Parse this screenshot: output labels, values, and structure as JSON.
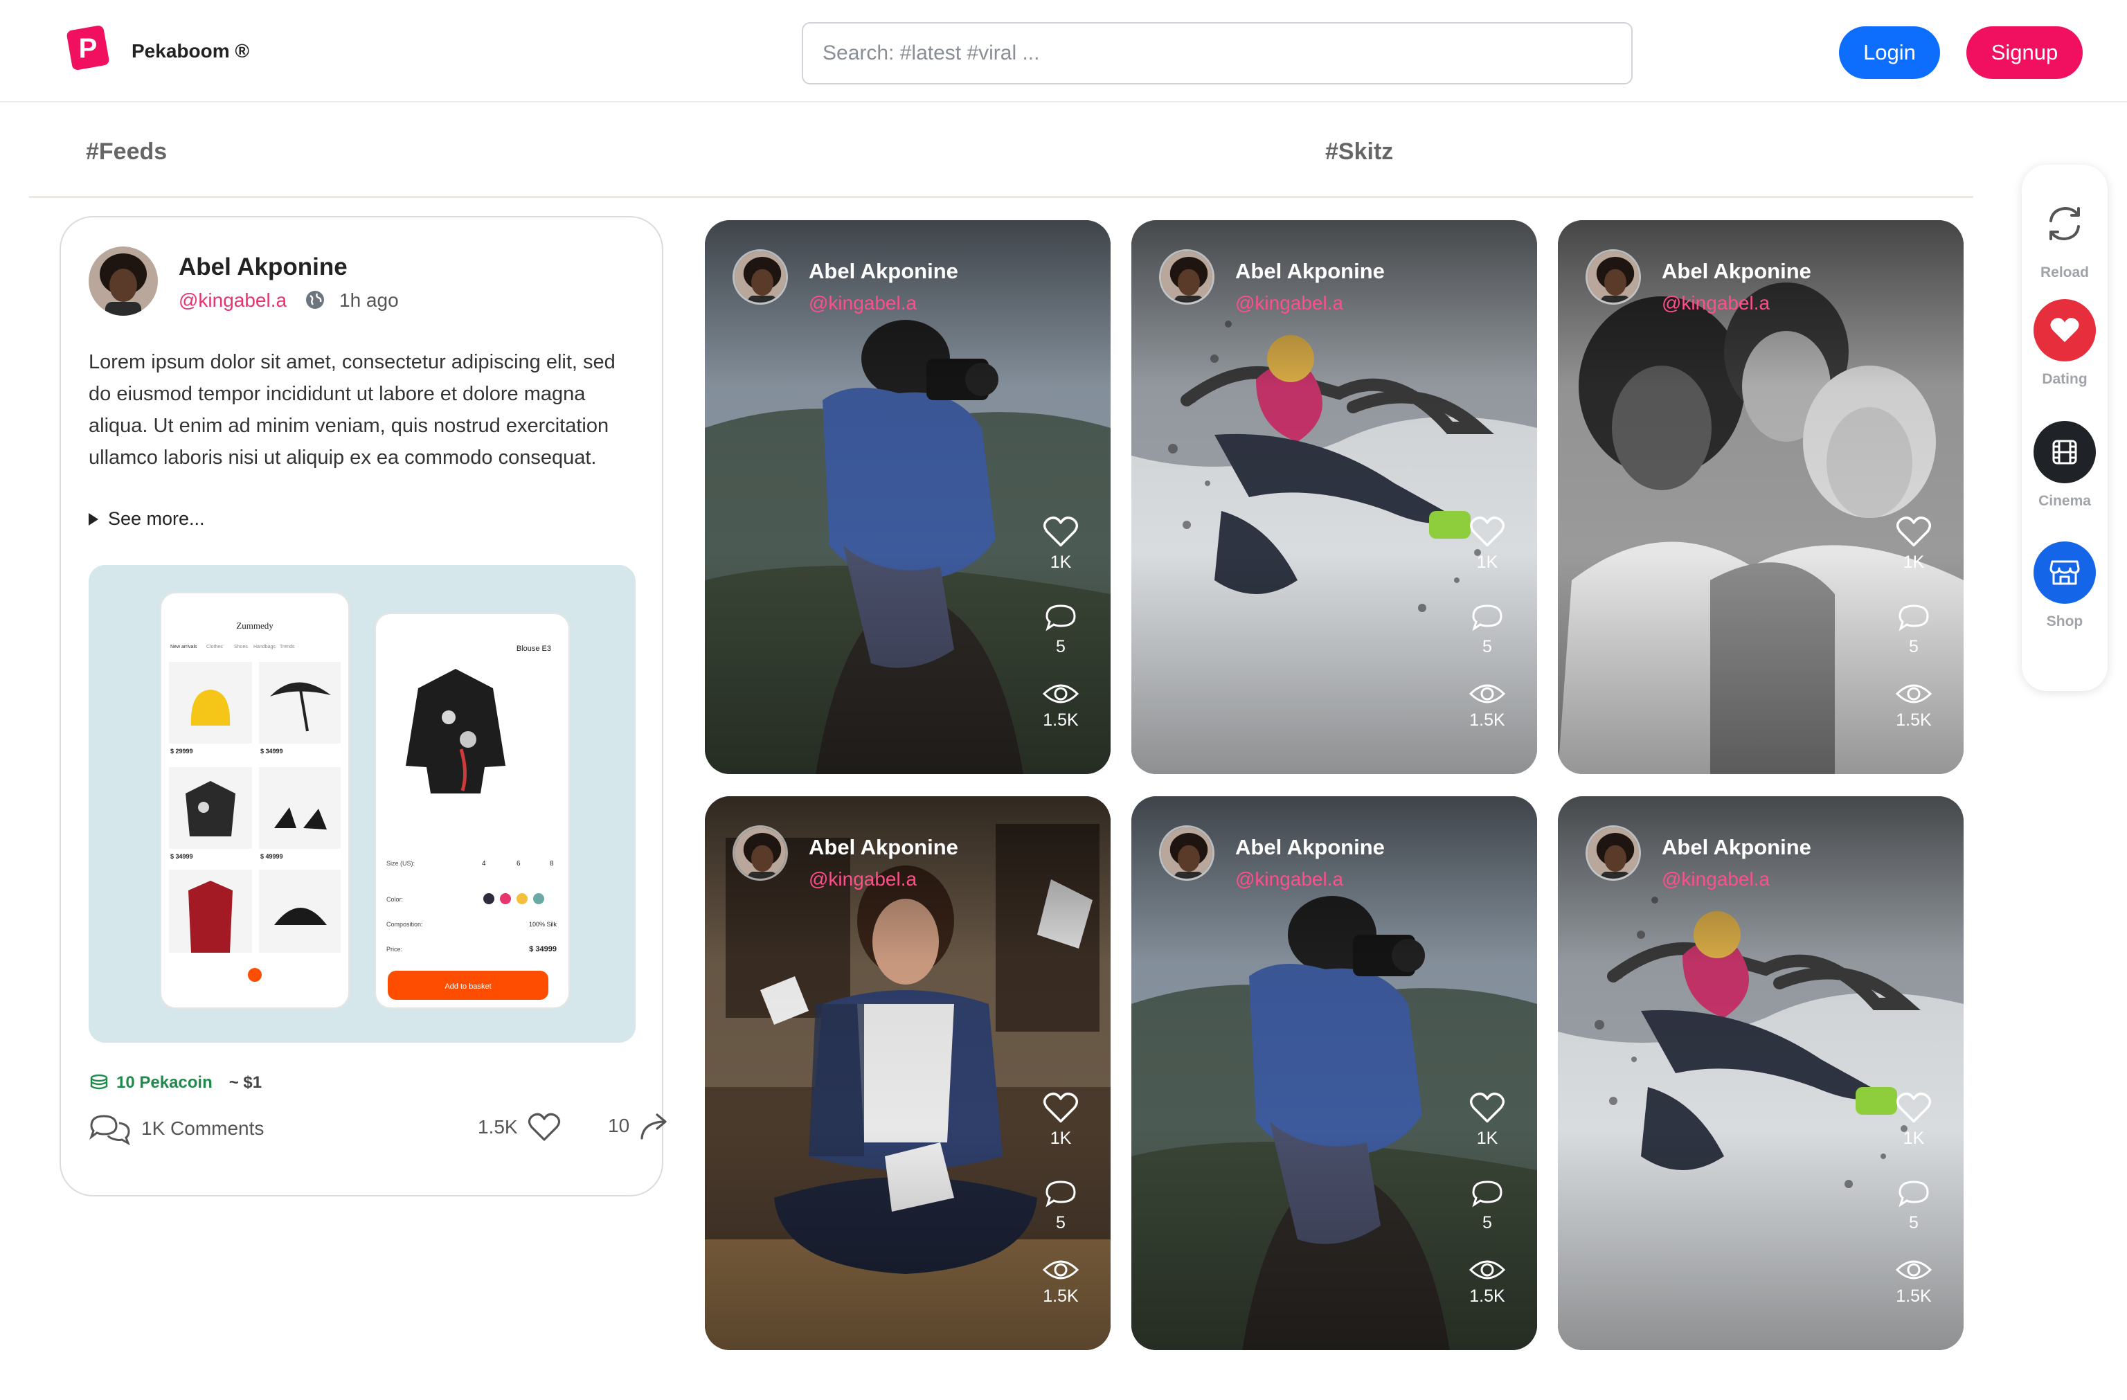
{
  "header": {
    "logo_letter": "P",
    "brand": "Pekaboom ®",
    "search_placeholder": "Search: #latest #viral ...",
    "login_label": "Login",
    "signup_label": "Signup"
  },
  "tabs": {
    "feeds": "#Feeds",
    "skitz": "#Skitz"
  },
  "post": {
    "author": "Abel Akponine",
    "handle": "@kingabel.a",
    "time": "1h ago",
    "text": "Lorem ipsum dolor sit amet, consectetur adipiscing elit, sed do eiusmod tempor incididunt ut labore et dolore magna aliqua. Ut enim ad minim veniam, quis nostrud exercitation ullamco laboris nisi ut aliquip ex ea commodo consequat.",
    "see_more": "See more...",
    "coin_amount": "10 Pekacoin",
    "coin_value": "~ $1",
    "comments": "1K Comments",
    "likes": "1.5K",
    "shares": "10",
    "media": {
      "phone1_title": "Zummedy",
      "phone1_tabs": [
        "New arrivals",
        "Clothes",
        "Shoes",
        "Handbags",
        "Trends"
      ],
      "phone1_price1": "$ 29999",
      "phone1_price2": "$ 34999",
      "phone1_price3": "$ 34999",
      "phone1_price4": "$ 49999",
      "phone2_title": "Blouse E3",
      "size_label": "Size (US):",
      "sizes": [
        "4",
        "6",
        "8"
      ],
      "color_label": "Color:",
      "composition_label": "Composition:",
      "composition_value": "100% Silk",
      "price_label": "Price:",
      "price_value": "$ 34999",
      "basket_label": "Add to basket"
    }
  },
  "skitz": [
    {
      "name": "Abel Akponine",
      "handle": "@kingabel.a",
      "likes": "1K",
      "comments": "5",
      "views": "1.5K",
      "scene": "photographer"
    },
    {
      "name": "Abel Akponine",
      "handle": "@kingabel.a",
      "likes": "1K",
      "comments": "5",
      "views": "1.5K",
      "scene": "dancer"
    },
    {
      "name": "Abel Akponine",
      "handle": "@kingabel.a",
      "likes": "1K",
      "comments": "5",
      "views": "1.5K",
      "scene": "friends"
    },
    {
      "name": "Abel Akponine",
      "handle": "@kingabel.a",
      "likes": "1K",
      "comments": "5",
      "views": "1.5K",
      "scene": "meditation"
    },
    {
      "name": "Abel Akponine",
      "handle": "@kingabel.a",
      "likes": "1K",
      "comments": "5",
      "views": "1.5K",
      "scene": "photographer"
    },
    {
      "name": "Abel Akponine",
      "handle": "@kingabel.a",
      "likes": "1K",
      "comments": "5",
      "views": "1.5K",
      "scene": "dancer"
    }
  ],
  "quick_menu": [
    {
      "label": "Reload",
      "icon": "reload-icon",
      "color": "#ffffff"
    },
    {
      "label": "Dating",
      "icon": "heart-icon",
      "color": "#e62e3d"
    },
    {
      "label": "Cinema",
      "icon": "film-icon",
      "color": "#1f2227"
    },
    {
      "label": "Shop",
      "icon": "store-icon",
      "color": "#1565e8"
    }
  ],
  "colors": {
    "accent_blue": "#0d6efd",
    "accent_pink": "#f0105f",
    "handle_pink": "#e6336f",
    "coin_green": "#1f8a4c"
  }
}
